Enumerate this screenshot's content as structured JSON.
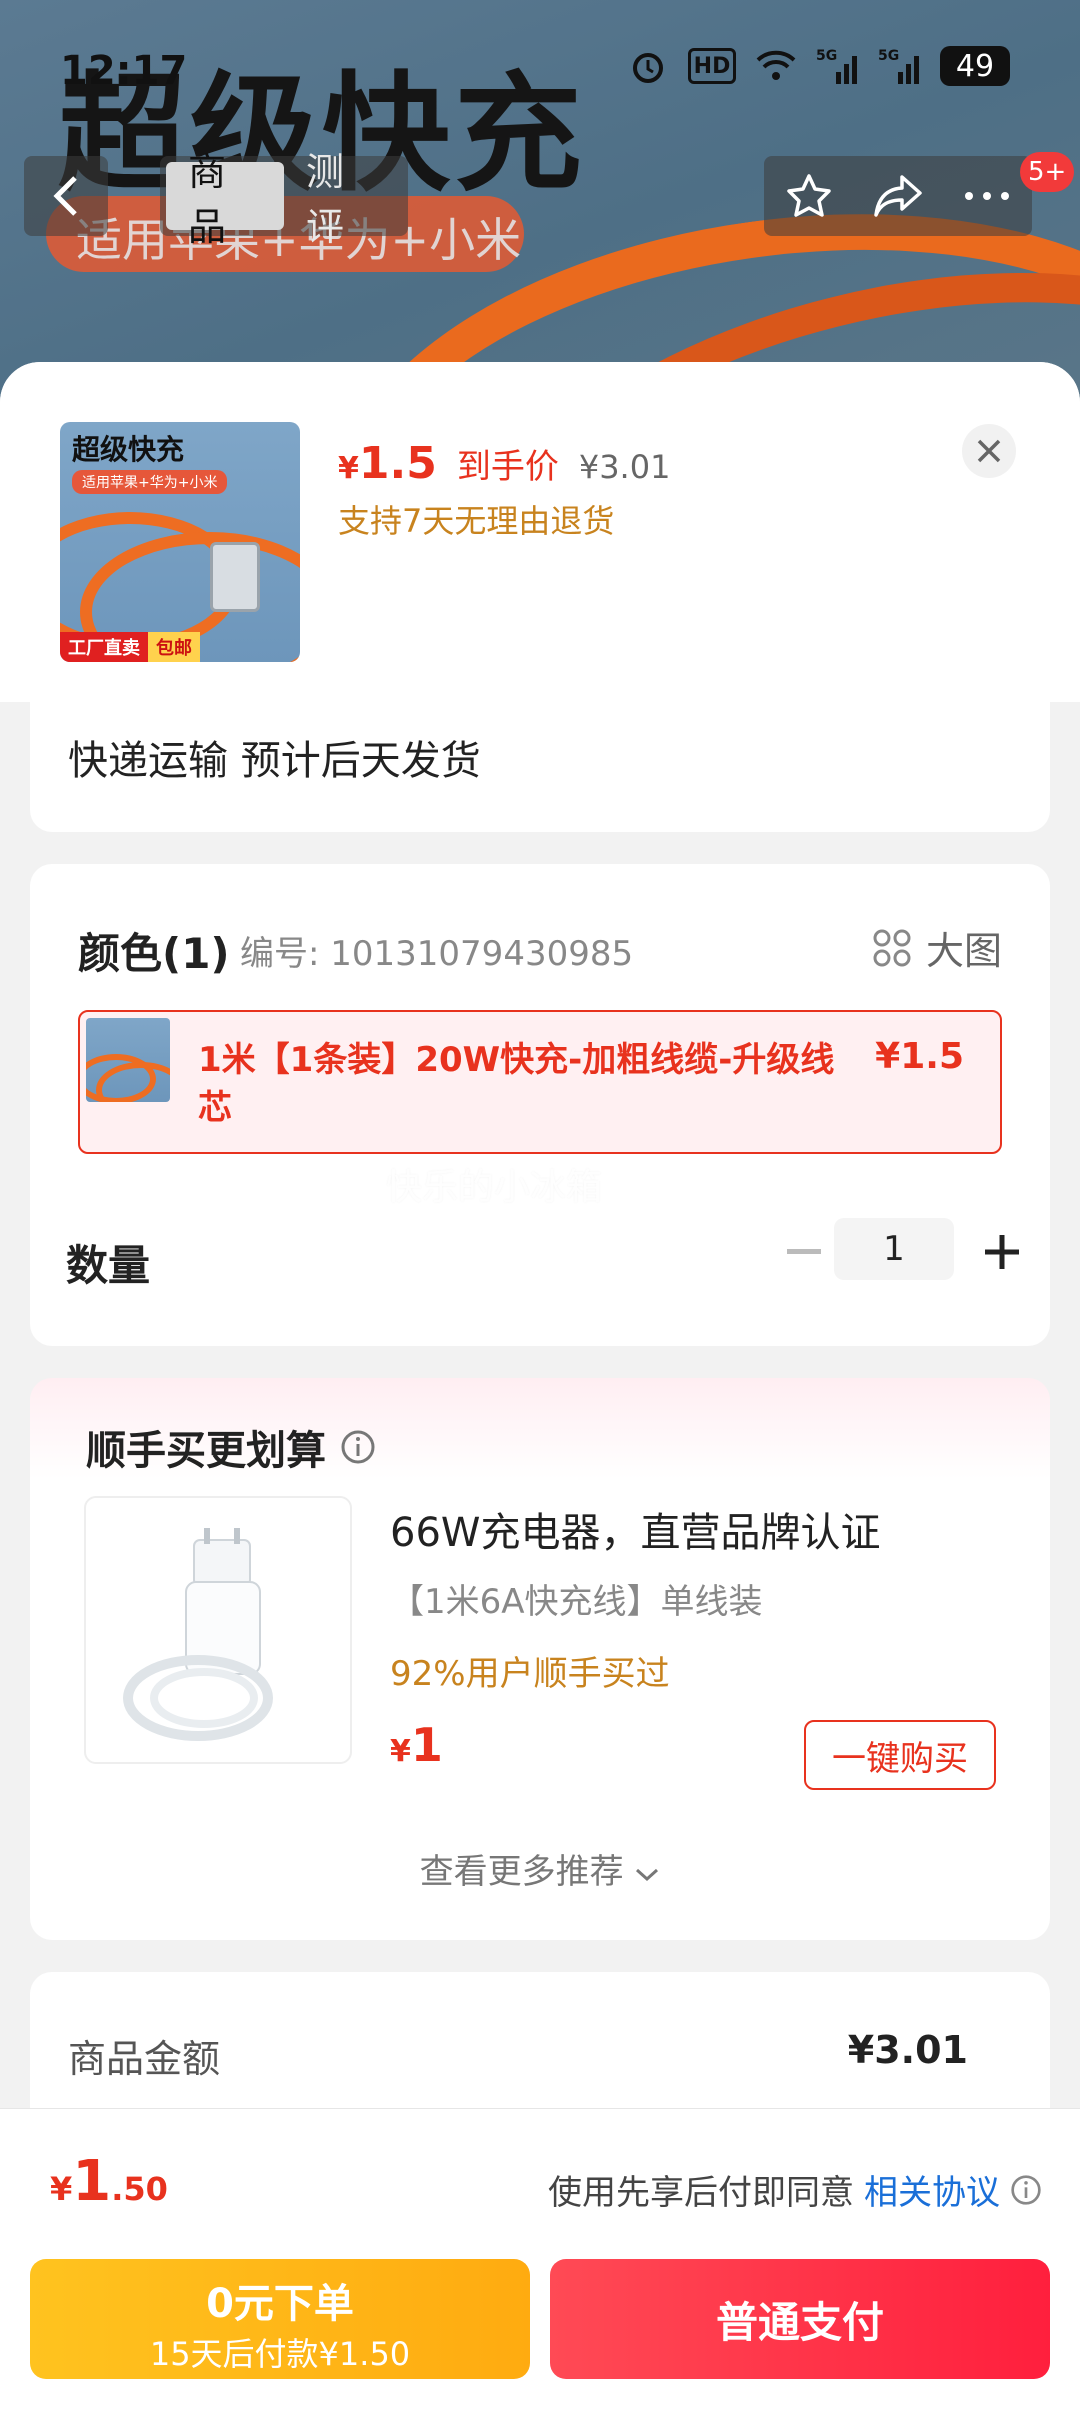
{
  "status_bar": {
    "time": "12:17",
    "network": "5G",
    "battery": "49"
  },
  "banner": {
    "title": "超级快充",
    "subtitle": "适用苹果+华为+小米"
  },
  "nav": {
    "tabs": [
      {
        "label": "商品",
        "active": true
      },
      {
        "label": "测评",
        "active": false
      }
    ],
    "badge": "5+"
  },
  "product": {
    "thumb_title": "超级快充",
    "thumb_subtitle": "适用苹果+华为+小米",
    "thumb_tag_factory": "工厂直卖",
    "thumb_tag_ship": "包邮",
    "price_currency": "¥",
    "price_value": "1.5",
    "price_label": "到手价",
    "original_price": "¥3.01",
    "return_policy": "支持7天无理由退货"
  },
  "shipping": {
    "text": "快递运输 预计后天发货"
  },
  "options": {
    "title": "颜色(1)",
    "code": "编号: 10131079430985",
    "big_image_label": "大图",
    "variant_name": "1米【1条装】20W快充-加粗线缆-升级线芯",
    "variant_price": "¥1.5",
    "watermark": "快乐的小冰箱",
    "quantity_label": "数量",
    "quantity": "1"
  },
  "recommend": {
    "title": "顺手买更划算",
    "item_name": "66W充电器，直营品牌认证",
    "item_spec": "【1米6A快充线】单线装",
    "item_bought": "92%用户顺手买过",
    "item_price_currency": "¥",
    "item_price": "1",
    "buy_button": "一键购买",
    "more": "查看更多推荐"
  },
  "amount": {
    "label": "商品金额",
    "value": "¥3.01"
  },
  "footer": {
    "total_currency": "¥",
    "total_int": "1",
    "total_dec": ".50",
    "agree_text": "使用先享后付即同意",
    "agree_link": "相关协议",
    "later_line1": "0元下单",
    "later_line2": "15天后付款¥1.50",
    "pay_button": "普通支付"
  },
  "colors": {
    "accent_red": "#e8321e",
    "gold": "#c8831e",
    "link_blue": "#1a6fd8"
  }
}
